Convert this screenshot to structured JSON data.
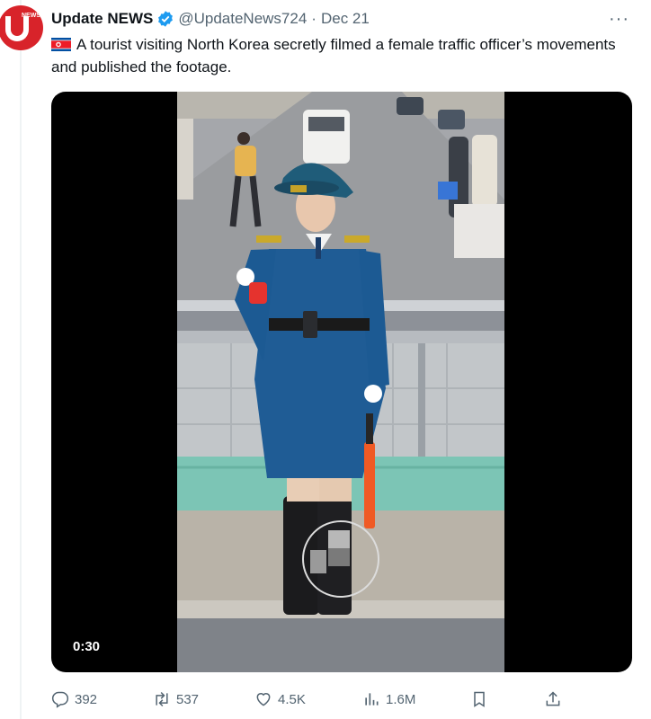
{
  "tweet": {
    "author_name": "Update NEWS",
    "avatar_text": "NEWS",
    "handle": "@UpdateNews724",
    "separator": "·",
    "date": "Dec 21",
    "text": "A tourist visiting North Korea secretly filmed a female traffic officer’s movements and published the footage.",
    "flag_icon": "north-korea-flag",
    "verified_color": "#1d9bf0"
  },
  "media": {
    "duration": "0:30"
  },
  "actions": {
    "replies": "392",
    "retweets": "537",
    "likes": "4.5K",
    "views": "1.6M"
  },
  "more_label": "···"
}
